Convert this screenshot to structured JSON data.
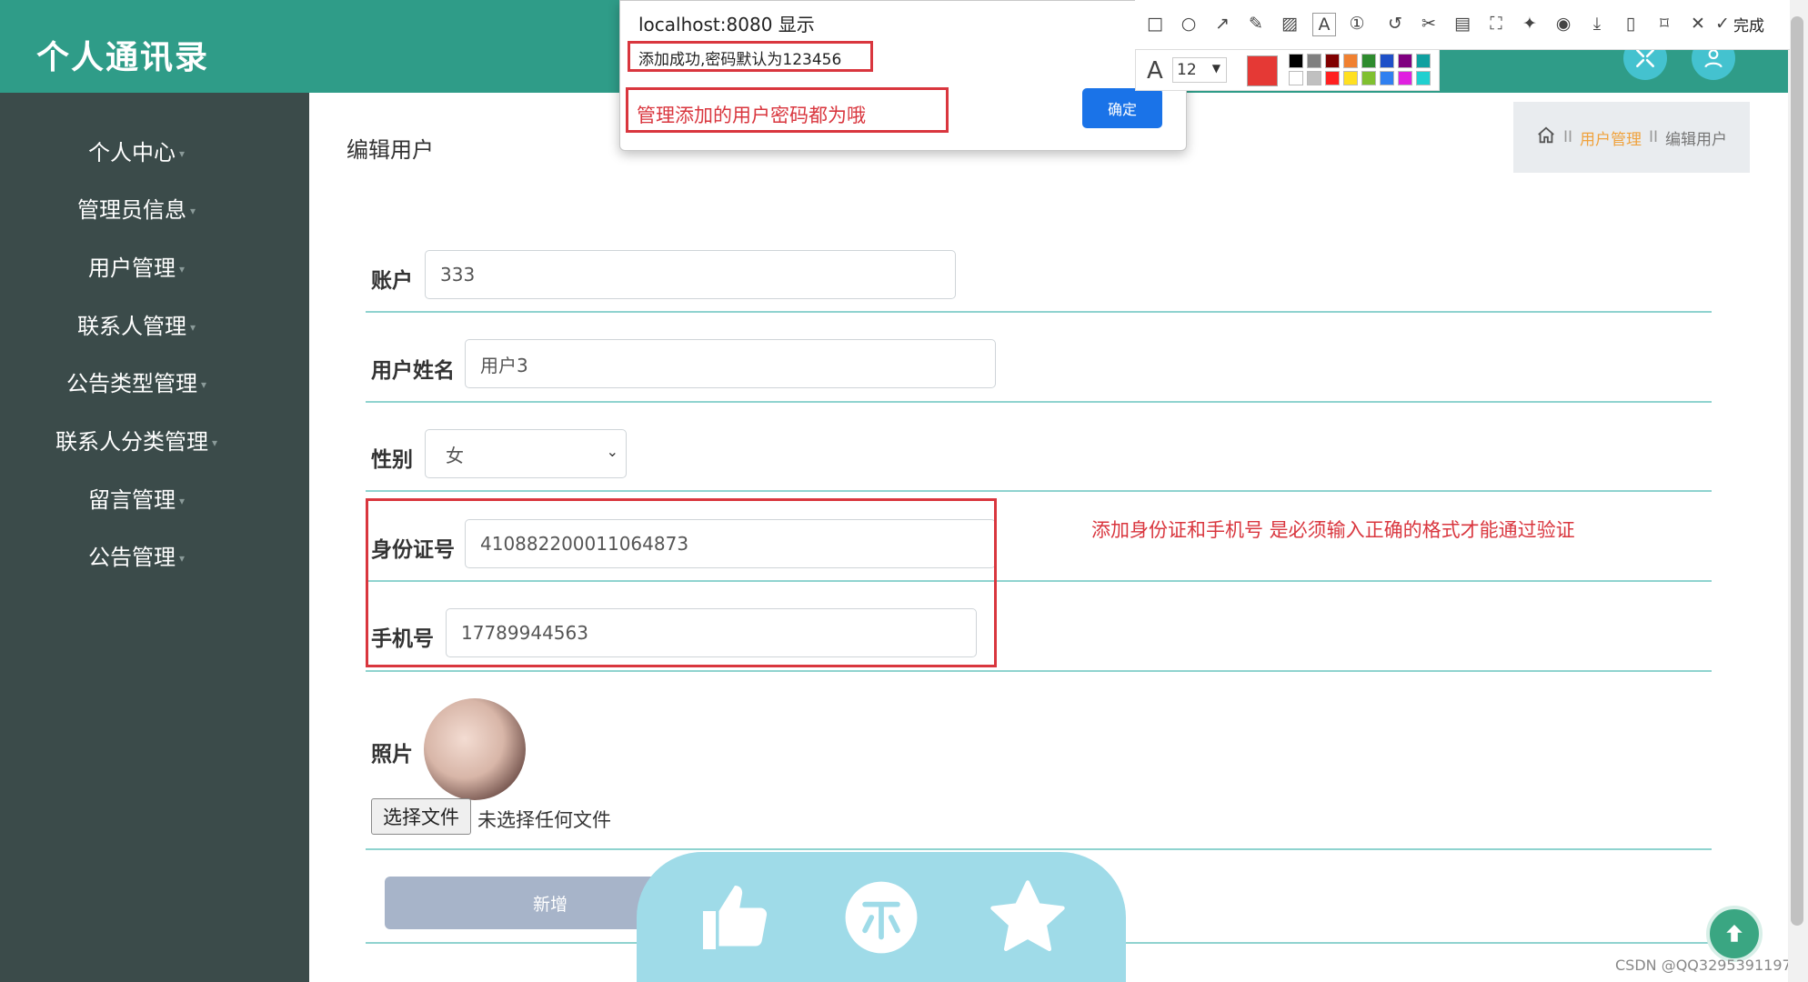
{
  "header": {
    "app_title": "个人通讯录"
  },
  "sidebar": {
    "items": [
      {
        "label": "个人中心"
      },
      {
        "label": "管理员信息"
      },
      {
        "label": "用户管理"
      },
      {
        "label": "联系人管理"
      },
      {
        "label": "公告类型管理"
      },
      {
        "label": "联系人分类管理"
      },
      {
        "label": "留言管理"
      },
      {
        "label": "公告管理"
      }
    ]
  },
  "page": {
    "title": "编辑用户",
    "breadcrumb": {
      "sep": "II",
      "parent": "用户管理",
      "current": "编辑用户"
    }
  },
  "form": {
    "account": {
      "label": "账户",
      "value": "333"
    },
    "name": {
      "label": "用户姓名",
      "value": "用户3"
    },
    "gender": {
      "label": "性别",
      "value": "女"
    },
    "id_number": {
      "label": "身份证号",
      "value": "410882200011064873"
    },
    "phone": {
      "label": "手机号",
      "value": "17789944563"
    },
    "photo": {
      "label": "照片",
      "choose_button": "选择文件",
      "no_file": "未选择任何文件"
    },
    "submit_label": "新增"
  },
  "annotations": {
    "validation_note": "添加身份证和手机号 是必须输入正确的格式才能通过验证"
  },
  "dialog": {
    "title": "localhost:8080 显示",
    "message": "添加成功,密码默认为123456",
    "note_text": "管理添加的用户密码都为哦",
    "ok_label": "确定"
  },
  "snip_toolbar": {
    "done_label": "完成",
    "font_size": "12",
    "current_color": "#e53935",
    "palette": [
      "#000000",
      "#808080",
      "#800000",
      "#f08030",
      "#2e8b2e",
      "#1e50c8",
      "#800080",
      "#0fa0a0",
      "#ffffff",
      "#c0c0c0",
      "#ff2020",
      "#ffe020",
      "#80c030",
      "#3080f0",
      "#e020e0",
      "#20d0d0"
    ]
  },
  "colors": {
    "header": "#2f9c88",
    "sidebar": "#3b4b4a",
    "accent_line": "#8fd3cf",
    "annotation_red": "#d9363e"
  },
  "watermark": "CSDN @QQ3295391197"
}
